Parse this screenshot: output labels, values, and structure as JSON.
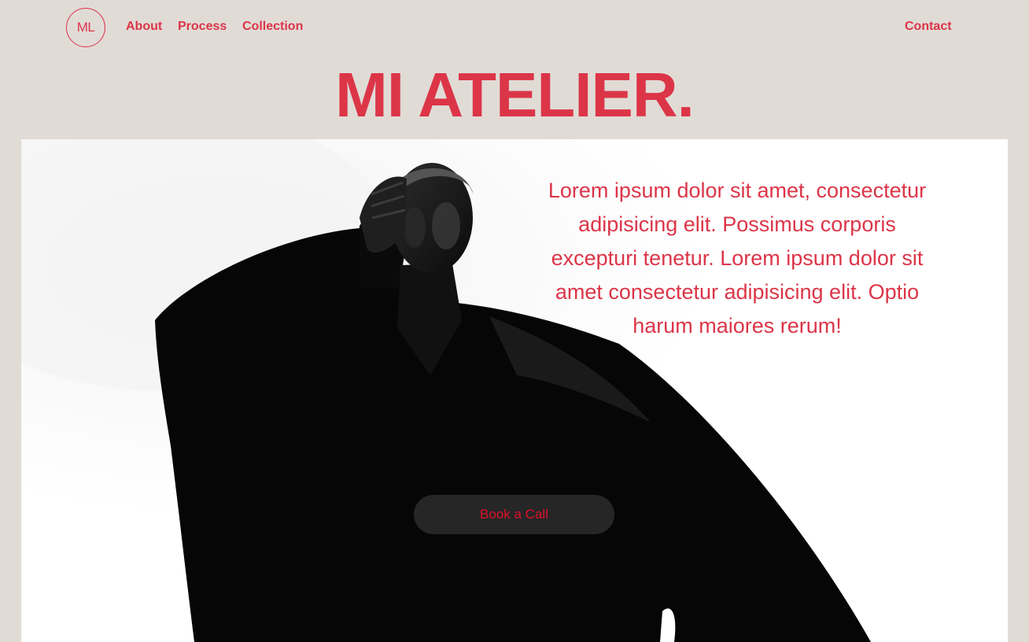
{
  "header": {
    "logo_text": "ML",
    "nav": [
      {
        "label": "About"
      },
      {
        "label": "Process"
      },
      {
        "label": "Collection"
      }
    ],
    "contact_label": "Contact"
  },
  "headline": "MI ATELIER.",
  "hero": {
    "image": "fashion-model-black-coat-photo",
    "text": "Lorem ipsum dolor sit amet, consectetur adipisicing elit. Possimus corporis excepturi tenetur. Lorem ipsum dolor sit amet consectetur adipisicing elit. Optio harum maiores rerum!",
    "cta_label": "Book a Call"
  },
  "colors": {
    "background": "#e1dbd6",
    "accent": "#dc3548",
    "hero_bg": "#ffffff"
  }
}
